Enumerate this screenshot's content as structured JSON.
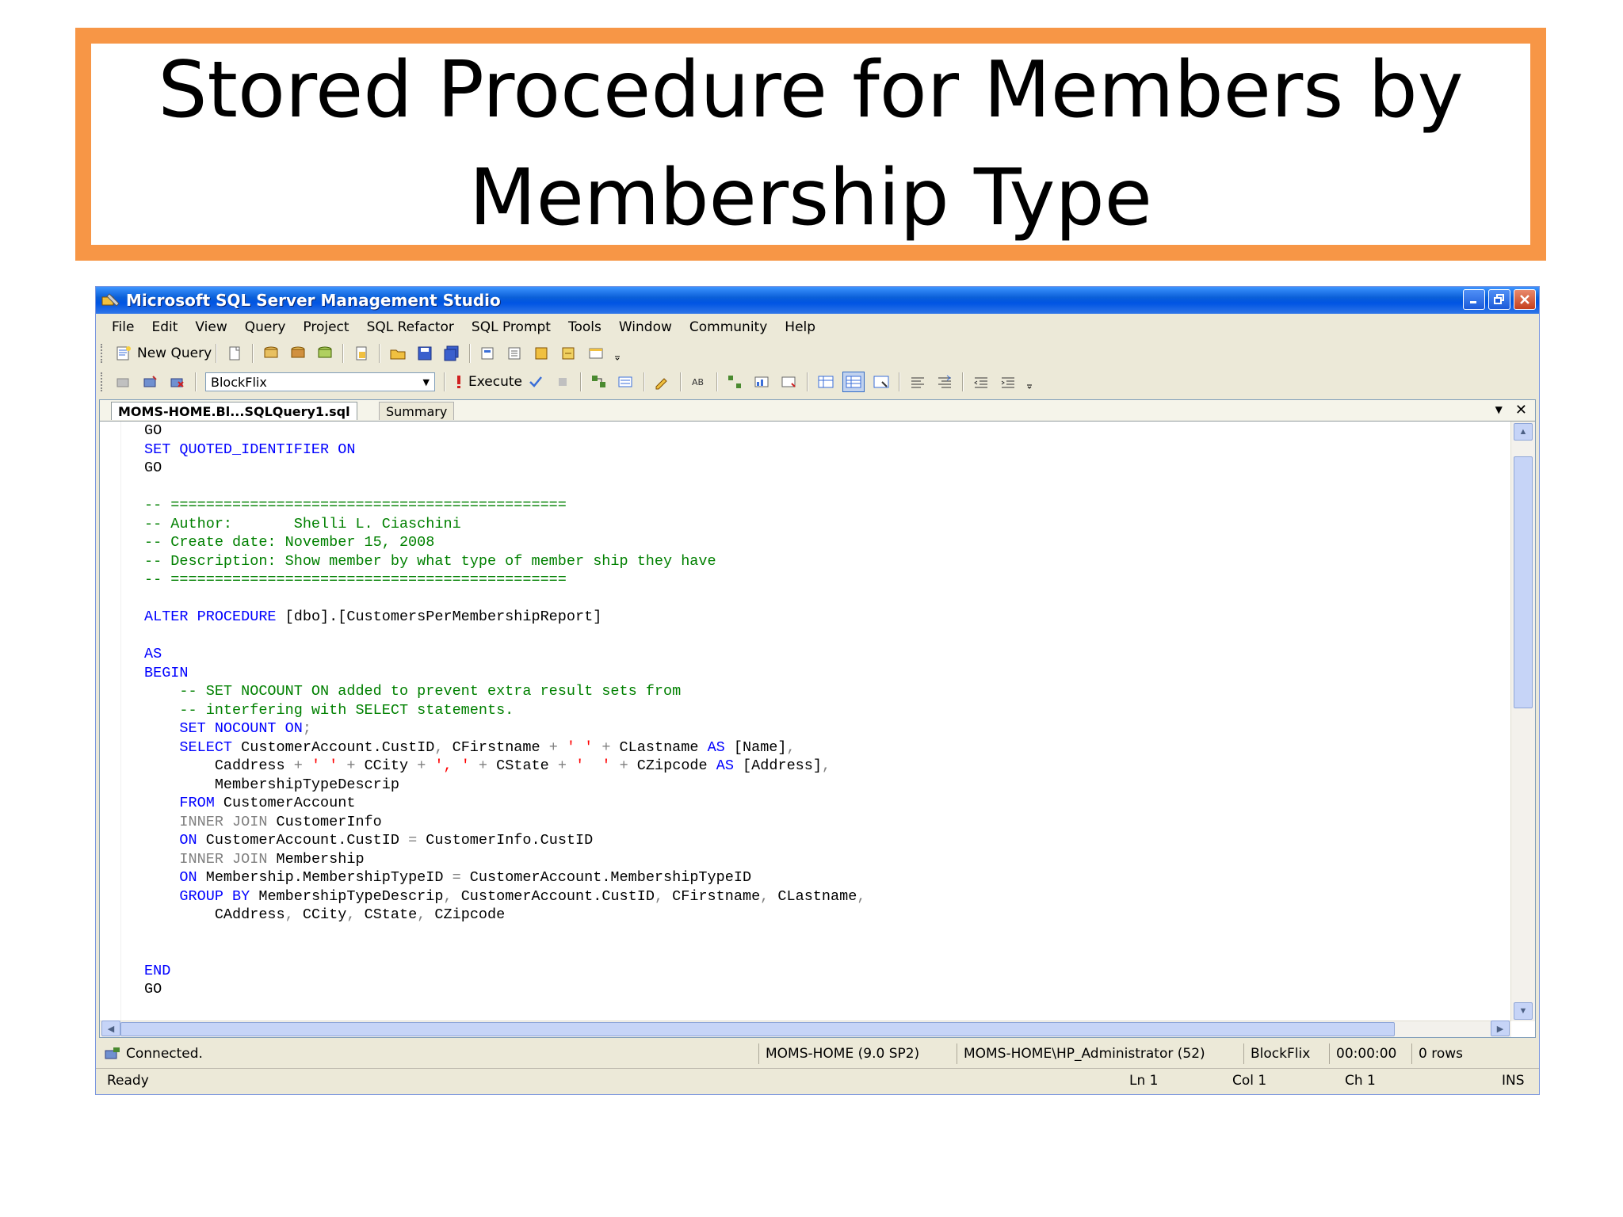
{
  "slide": {
    "title_line1": "Stored Procedure for Members by",
    "title_line2": "Membership Type",
    "border_color": "#f79646"
  },
  "window": {
    "title": "Microsoft SQL Server Management Studio",
    "controls": [
      "minimize-icon",
      "restore-icon",
      "close-icon"
    ]
  },
  "menu": [
    "File",
    "Edit",
    "View",
    "Query",
    "Project",
    "SQL Refactor",
    "SQL Prompt",
    "Tools",
    "Window",
    "Community",
    "Help"
  ],
  "toolbar1": {
    "new_query": "New Query"
  },
  "toolbar2": {
    "database": "BlockFlix",
    "execute": "Execute"
  },
  "tabs": {
    "active": "MOMS-HOME.Bl...SQLQuery1.sql",
    "inactive": "Summary"
  },
  "code_lines": [
    [
      [
        "GO",
        ""
      ]
    ],
    [
      [
        "SET QUOTED_IDENTIFIER ON",
        "kw"
      ]
    ],
    [
      [
        "GO",
        ""
      ]
    ],
    [
      [
        "",
        ""
      ]
    ],
    [
      [
        "-- =============================================",
        "cm"
      ]
    ],
    [
      [
        "-- Author:       Shelli L. Ciaschini",
        "cm"
      ]
    ],
    [
      [
        "-- Create date: November 15, 2008",
        "cm"
      ]
    ],
    [
      [
        "-- Description: Show member by what type of member ship they have",
        "cm"
      ]
    ],
    [
      [
        "-- =============================================",
        "cm"
      ]
    ],
    [
      [
        "",
        ""
      ]
    ],
    [
      [
        "ALTER PROCEDURE",
        "kw"
      ],
      [
        " [dbo].[CustomersPerMembershipReport]",
        ""
      ]
    ],
    [
      [
        "",
        ""
      ]
    ],
    [
      [
        "AS",
        "kw"
      ]
    ],
    [
      [
        "BEGIN",
        "kw"
      ]
    ],
    [
      [
        "    -- SET NOCOUNT ON added to prevent extra result sets from",
        "cm"
      ]
    ],
    [
      [
        "    -- interfering with SELECT statements.",
        "cm"
      ]
    ],
    [
      [
        "    SET NOCOUNT ON",
        "kw"
      ],
      [
        ";",
        "gr"
      ]
    ],
    [
      [
        "    SELECT",
        "kw"
      ],
      [
        " CustomerAccount.CustID",
        ""
      ],
      [
        ",",
        "gr"
      ],
      [
        " CFirstname ",
        ""
      ],
      [
        "+",
        "gr"
      ],
      [
        " ' ' ",
        "st"
      ],
      [
        "+",
        "gr"
      ],
      [
        " CLastname ",
        ""
      ],
      [
        "AS",
        "kw"
      ],
      [
        " [Name]",
        ""
      ],
      [
        ",",
        "gr"
      ]
    ],
    [
      [
        "        Caddress ",
        ""
      ],
      [
        "+",
        "gr"
      ],
      [
        " ' ' ",
        "st"
      ],
      [
        "+",
        "gr"
      ],
      [
        " CCity ",
        ""
      ],
      [
        "+",
        "gr"
      ],
      [
        " ', ' ",
        "st"
      ],
      [
        "+",
        "gr"
      ],
      [
        " CState ",
        ""
      ],
      [
        "+",
        "gr"
      ],
      [
        " '  ' ",
        "st"
      ],
      [
        "+",
        "gr"
      ],
      [
        " CZipcode ",
        ""
      ],
      [
        "AS",
        "kw"
      ],
      [
        " [Address]",
        ""
      ],
      [
        ",",
        "gr"
      ]
    ],
    [
      [
        "        MembershipTypeDescrip",
        ""
      ]
    ],
    [
      [
        "    FROM",
        "kw"
      ],
      [
        " CustomerAccount",
        ""
      ]
    ],
    [
      [
        "    INNER JOIN",
        "gr"
      ],
      [
        " CustomerInfo",
        ""
      ]
    ],
    [
      [
        "    ON",
        "kw"
      ],
      [
        " CustomerAccount.CustID ",
        ""
      ],
      [
        "=",
        "gr"
      ],
      [
        " CustomerInfo.CustID",
        ""
      ]
    ],
    [
      [
        "    INNER JOIN",
        "gr"
      ],
      [
        " Membership",
        ""
      ]
    ],
    [
      [
        "    ON",
        "kw"
      ],
      [
        " Membership.MembershipTypeID ",
        ""
      ],
      [
        "=",
        "gr"
      ],
      [
        " CustomerAccount.MembershipTypeID",
        ""
      ]
    ],
    [
      [
        "    GROUP BY",
        "kw"
      ],
      [
        " MembershipTypeDescrip",
        ""
      ],
      [
        ",",
        "gr"
      ],
      [
        " CustomerAccount.CustID",
        ""
      ],
      [
        ",",
        "gr"
      ],
      [
        " CFirstname",
        ""
      ],
      [
        ",",
        "gr"
      ],
      [
        " CLastname",
        ""
      ],
      [
        ",",
        "gr"
      ]
    ],
    [
      [
        "        CAddress",
        ""
      ],
      [
        ",",
        "gr"
      ],
      [
        " CCity",
        ""
      ],
      [
        ",",
        "gr"
      ],
      [
        " CState",
        ""
      ],
      [
        ",",
        "gr"
      ],
      [
        " CZipcode",
        ""
      ]
    ],
    [
      [
        "",
        ""
      ]
    ],
    [
      [
        "",
        ""
      ]
    ],
    [
      [
        "END",
        "kw"
      ]
    ],
    [
      [
        "GO",
        ""
      ]
    ]
  ],
  "status": {
    "connected": "Connected.",
    "server": "MOMS-HOME (9.0 SP2)",
    "user": "MOMS-HOME\\HP_Administrator (52)",
    "database": "BlockFlix",
    "elapsed": "00:00:00",
    "rows": "0 rows"
  },
  "status2": {
    "ready": "Ready",
    "ln": "Ln 1",
    "col": "Col 1",
    "ch": "Ch 1",
    "mode": "INS"
  }
}
